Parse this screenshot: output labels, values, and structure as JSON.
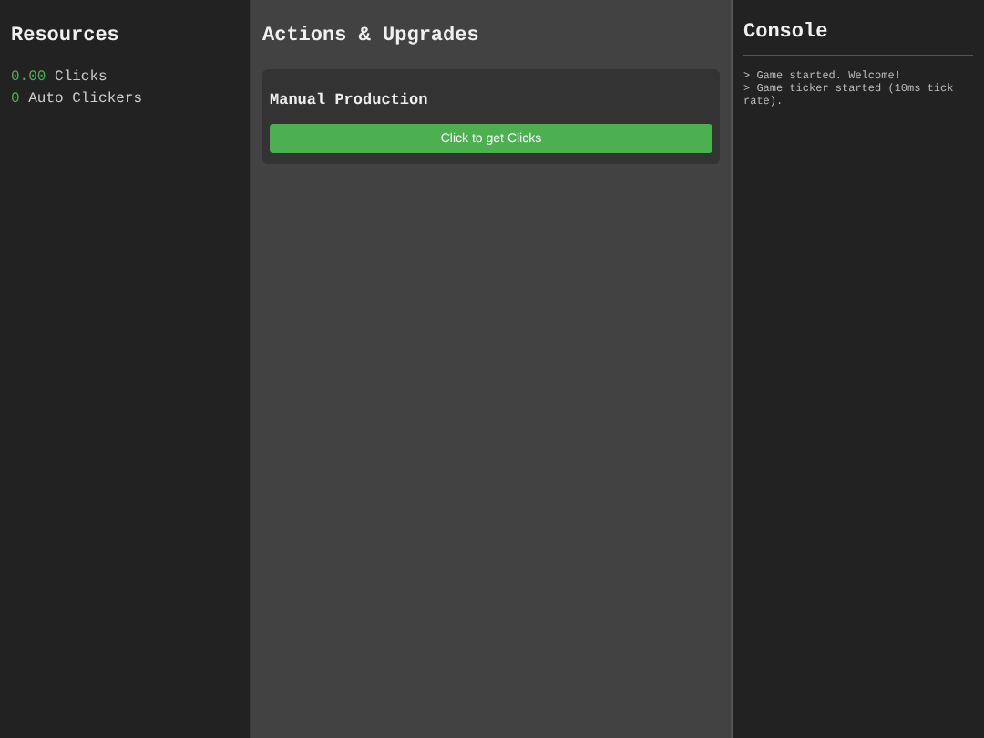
{
  "resources": {
    "title": "Resources",
    "items": [
      {
        "value": "0.00",
        "label": "Clicks"
      },
      {
        "value": "0",
        "label": "Auto Clickers"
      }
    ]
  },
  "actions": {
    "title": "Actions & Upgrades",
    "cards": [
      {
        "title": "Manual Production",
        "button": "Click to get Clicks"
      }
    ]
  },
  "console": {
    "title": "Console",
    "lines": [
      "> Game started. Welcome!",
      "> Game ticker started (10ms tick rate)."
    ]
  }
}
